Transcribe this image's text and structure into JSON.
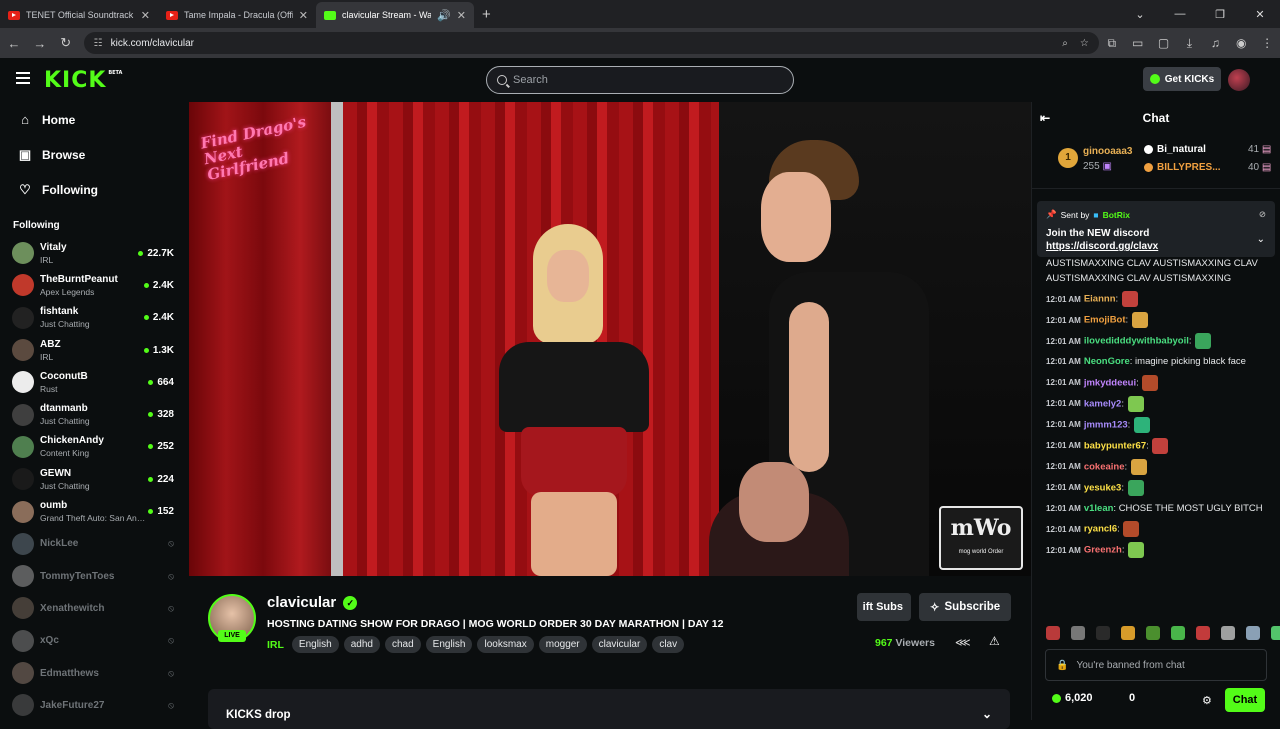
{
  "browser": {
    "tabs": [
      {
        "title": "TENET Official Soundtrack | FUL",
        "favicon": "youtube-icon"
      },
      {
        "title": "Tame Impala - Dracula (Official",
        "favicon": "youtube-icon"
      },
      {
        "title": "clavicular Stream - Watch Li",
        "favicon": "kick-icon"
      }
    ],
    "url": "kick.com/clavicular"
  },
  "header": {
    "logo": "KICK",
    "logo_badge": "BETA",
    "search_placeholder": "Search",
    "get_kicks_label": "Get KICKs"
  },
  "sidebar": {
    "nav": [
      {
        "label": "Home",
        "icon": "home-icon"
      },
      {
        "label": "Browse",
        "icon": "browse-icon"
      },
      {
        "label": "Following",
        "icon": "heart-icon"
      }
    ],
    "following_title": "Following",
    "channels": [
      {
        "name": "Vitaly",
        "category": "IRL",
        "viewers": "22.7K",
        "color": "#6d8f5c"
      },
      {
        "name": "TheBurntPeanut",
        "category": "Apex Legends",
        "viewers": "2.4K",
        "color": "#c0392b"
      },
      {
        "name": "fishtank",
        "category": "Just Chatting",
        "viewers": "2.4K",
        "color": "#222222"
      },
      {
        "name": "ABZ",
        "category": "IRL",
        "viewers": "1.3K",
        "color": "#5b4a3f"
      },
      {
        "name": "CoconutB",
        "category": "Rust",
        "viewers": "664",
        "color": "#ececec"
      },
      {
        "name": "dtanmanb",
        "category": "Just Chatting",
        "viewers": "328",
        "color": "#3f3f3f"
      },
      {
        "name": "ChickenAndy",
        "category": "Content King",
        "viewers": "252",
        "color": "#4f7f4f"
      },
      {
        "name": "GEWN",
        "category": "Just Chatting",
        "viewers": "224",
        "color": "#1a1a1a"
      },
      {
        "name": "oumb",
        "category": "Grand Theft Auto: San Andreas",
        "viewers": "152",
        "color": "#8a6d5a"
      }
    ],
    "offline": [
      {
        "name": "NickLee",
        "color": "#7a8b99"
      },
      {
        "name": "TommyTenToes",
        "color": "#bfbfbf"
      },
      {
        "name": "Xenathewitch",
        "color": "#8c7a6a"
      },
      {
        "name": "xQc",
        "color": "#9c9c9c"
      },
      {
        "name": "Edmatthews",
        "color": "#a89080"
      },
      {
        "name": "JakeFuture27",
        "color": "#707070"
      }
    ]
  },
  "video": {
    "overlay_sign": "Find Drago's Next Girlfriend",
    "logo_text": "mWo",
    "logo_caption": "mog world Order"
  },
  "stream": {
    "channel": "clavicular",
    "live_label": "LIVE",
    "title": "HOSTING DATING SHOW FOR DRAGO | MOG WORLD ORDER 30 DAY MARATHON | DAY 12",
    "category": "IRL",
    "tags": [
      "English",
      "adhd",
      "chad",
      "English",
      "looksmax",
      "mogger",
      "clavicular",
      "clav"
    ],
    "gift_label": "ift Subs",
    "subscribe_label": "Subscribe",
    "viewers": "967",
    "viewers_label": "Viewers",
    "kicks_drop": "KICKS drop"
  },
  "chat": {
    "title": "Chat",
    "leaderboard": {
      "first": {
        "name": "ginooaaa3",
        "rank": "1",
        "value": "255"
      },
      "others": [
        {
          "name": "Bi_natural",
          "value": "41",
          "color": "#ffffff"
        },
        {
          "name": "BILLYPRES...",
          "value": "40",
          "color": "#f0a040"
        }
      ]
    },
    "pinned": {
      "sent_by": "Sent by",
      "bot": "BotRix",
      "message": "Join the NEW discord",
      "link": "https://discord.gg/clavx"
    },
    "spam_text": "AUSTISMAXXING   CLAV AUSTISMAXXING   CLAV AUSTISMAXXING   CLAV AUSTISMAXXING",
    "messages": [
      {
        "time": "12:01 AM",
        "user": "Eiannn",
        "color": "#e8b055",
        "text": ""
      },
      {
        "time": "12:01 AM",
        "user": "EmojiBot",
        "color": "#f0a040",
        "text": ""
      },
      {
        "time": "12:01 AM",
        "user": "ilovedidddywithbabyoil",
        "color": "#4ade80",
        "text": ""
      },
      {
        "time": "12:01 AM",
        "user": "NeonGore",
        "color": "#4ade80",
        "text": "imagine picking black face"
      },
      {
        "time": "12:01 AM",
        "user": "jmkyddeeui",
        "color": "#c084fc",
        "text": ""
      },
      {
        "time": "12:01 AM",
        "user": "kamely2",
        "color": "#a78bfa",
        "text": ""
      },
      {
        "time": "12:01 AM",
        "user": "jmmm123",
        "color": "#a78bfa",
        "text": ""
      },
      {
        "time": "12:01 AM",
        "user": "babypunter67",
        "color": "#fde047",
        "text": ""
      },
      {
        "time": "12:01 AM",
        "user": "cokeaine",
        "color": "#f87171",
        "text": ""
      },
      {
        "time": "12:01 AM",
        "user": "yesuke3",
        "color": "#fde047",
        "text": ""
      },
      {
        "time": "12:01 AM",
        "user": "v1lean",
        "color": "#4ade80",
        "text": "CHOSE THE MOST UGLY BITCH"
      },
      {
        "time": "12:01 AM",
        "user": "ryancl6",
        "color": "#fde047",
        "text": ""
      },
      {
        "time": "12:01 AM",
        "user": "Greenzh",
        "color": "#f87171",
        "text": ""
      }
    ],
    "banned_text": "You're banned from chat",
    "points": "6,020",
    "kicks": "0",
    "chat_button": "Chat"
  }
}
